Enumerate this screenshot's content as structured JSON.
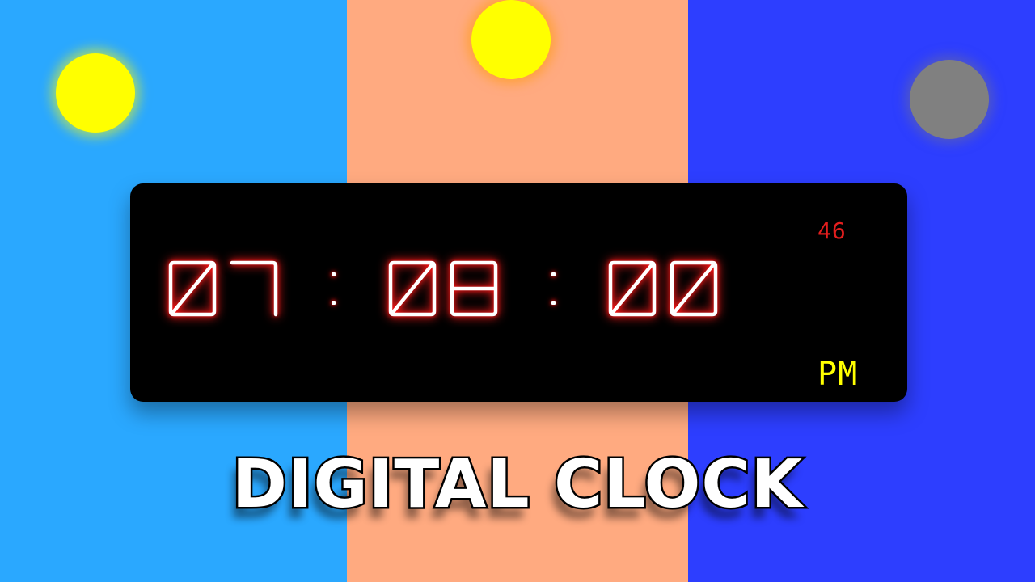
{
  "scene": {
    "panels": [
      {
        "name": "left",
        "color": "#2aa8ff"
      },
      {
        "name": "middle",
        "color": "#ffaa80"
      },
      {
        "name": "right",
        "color": "#2d3eff"
      }
    ],
    "orbs": [
      {
        "name": "left-sun",
        "color": "#ffff00",
        "glow": "#ffff00"
      },
      {
        "name": "middle-sun",
        "color": "#ffff00",
        "glow": "#ff9900"
      },
      {
        "name": "right-moon",
        "color": "#808080",
        "glow": "#6a6a9a"
      }
    ]
  },
  "clock": {
    "hours": "07",
    "minutes": "08",
    "seconds_display": "00",
    "small_seconds": "46",
    "period": "PM",
    "colors": {
      "background": "#000000",
      "digit": "#ffffff",
      "glow": "#ff1a1a",
      "small_seconds": "#e31e1e",
      "period": "#ffff00"
    }
  },
  "title": "DIGITAL CLOCK"
}
